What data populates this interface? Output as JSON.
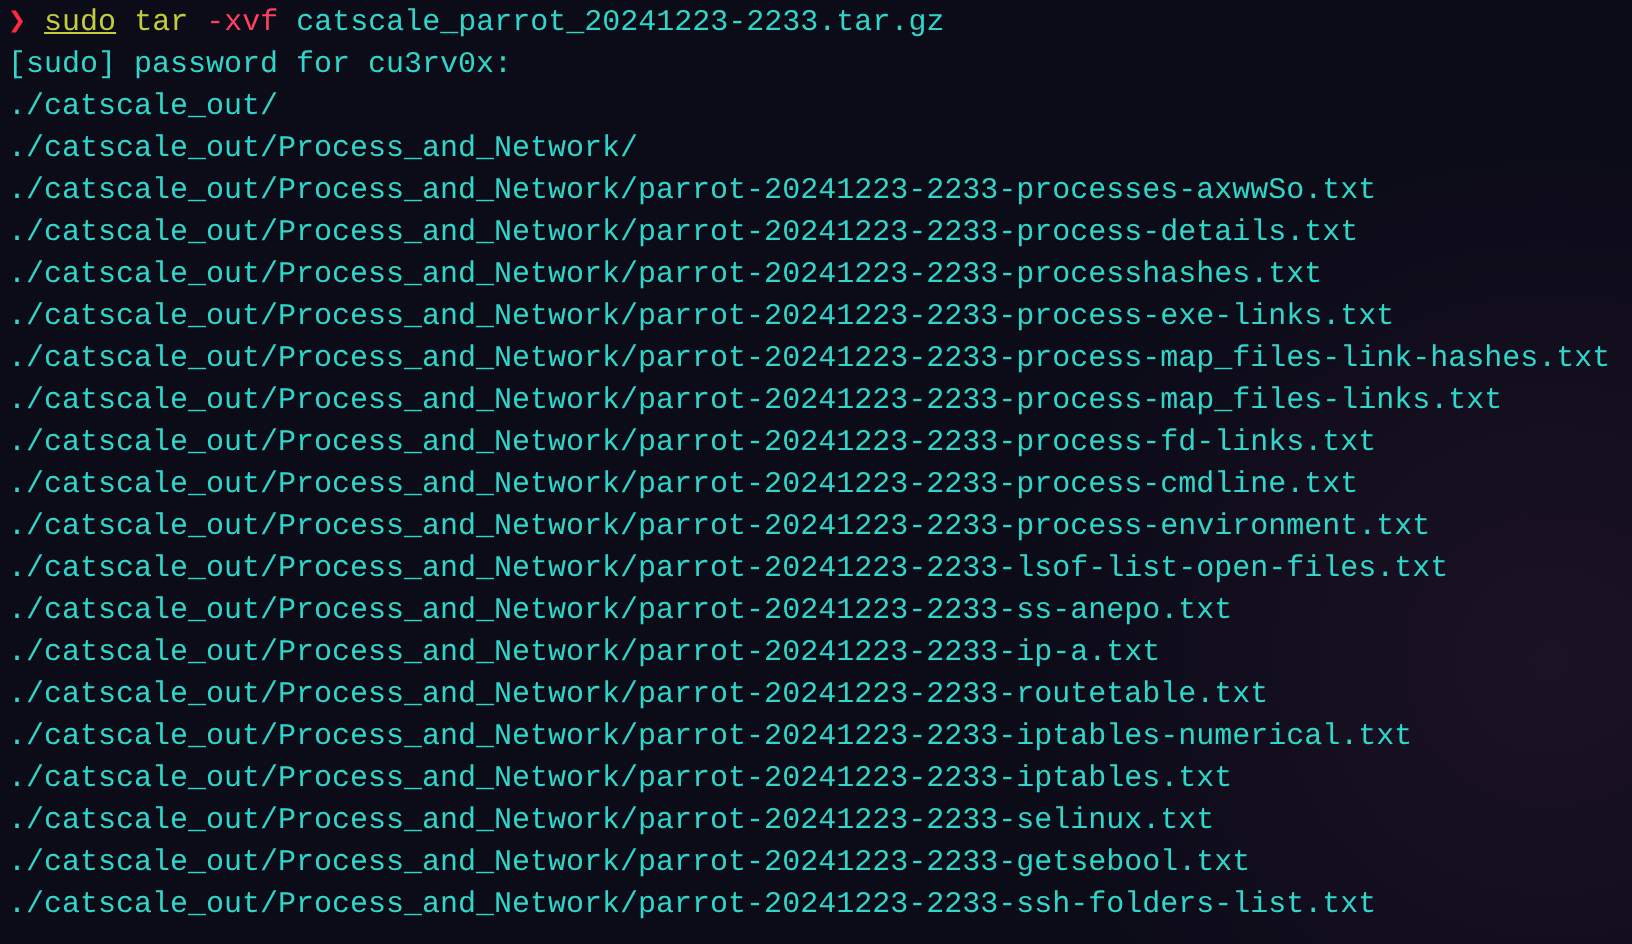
{
  "prompt": {
    "symbol": "❯",
    "tokens": [
      {
        "text": "sudo",
        "kind": "command"
      },
      {
        "text": "tar",
        "kind": "builtin"
      },
      {
        "text": "-xvf",
        "kind": "flag"
      },
      {
        "text": "catscale_parrot_20241223-2233.tar.gz",
        "kind": "argument"
      }
    ]
  },
  "output": [
    "[sudo] password for cu3rv0x:",
    "./catscale_out/",
    "./catscale_out/Process_and_Network/",
    "./catscale_out/Process_and_Network/parrot-20241223-2233-processes-axwwSo.txt",
    "./catscale_out/Process_and_Network/parrot-20241223-2233-process-details.txt",
    "./catscale_out/Process_and_Network/parrot-20241223-2233-processhashes.txt",
    "./catscale_out/Process_and_Network/parrot-20241223-2233-process-exe-links.txt",
    "./catscale_out/Process_and_Network/parrot-20241223-2233-process-map_files-link-hashes.txt",
    "./catscale_out/Process_and_Network/parrot-20241223-2233-process-map_files-links.txt",
    "./catscale_out/Process_and_Network/parrot-20241223-2233-process-fd-links.txt",
    "./catscale_out/Process_and_Network/parrot-20241223-2233-process-cmdline.txt",
    "./catscale_out/Process_and_Network/parrot-20241223-2233-process-environment.txt",
    "./catscale_out/Process_and_Network/parrot-20241223-2233-lsof-list-open-files.txt",
    "./catscale_out/Process_and_Network/parrot-20241223-2233-ss-anepo.txt",
    "./catscale_out/Process_and_Network/parrot-20241223-2233-ip-a.txt",
    "./catscale_out/Process_and_Network/parrot-20241223-2233-routetable.txt",
    "./catscale_out/Process_and_Network/parrot-20241223-2233-iptables-numerical.txt",
    "./catscale_out/Process_and_Network/parrot-20241223-2233-iptables.txt",
    "./catscale_out/Process_and_Network/parrot-20241223-2233-selinux.txt",
    "./catscale_out/Process_and_Network/parrot-20241223-2233-getsebool.txt",
    "./catscale_out/Process_and_Network/parrot-20241223-2233-ssh-folders-list.txt"
  ]
}
